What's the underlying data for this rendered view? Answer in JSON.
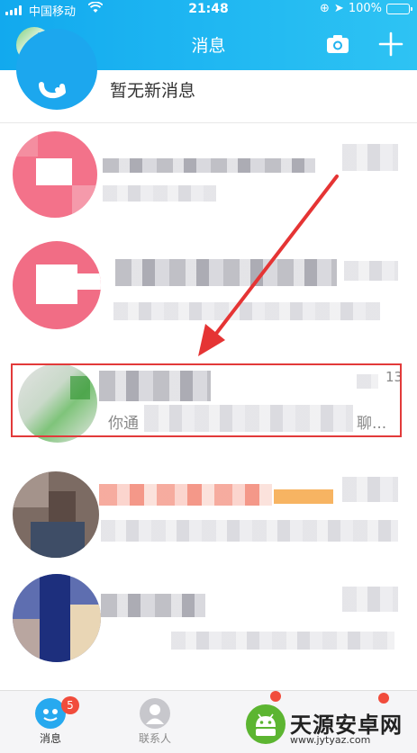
{
  "status": {
    "carrier": "中国移动",
    "time": "21:48",
    "battery": "100%"
  },
  "header": {
    "title": "消息"
  },
  "notice": {
    "text": "暂无新消息"
  },
  "chats": [
    {
      "time": "13",
      "preview_start": "你通",
      "preview_end": "聊..."
    }
  ],
  "tabs": [
    {
      "label": "消息",
      "badge": "5"
    },
    {
      "label": "联系人"
    }
  ],
  "watermark": {
    "text": "天源安卓网",
    "url": "www.jytyaz.com"
  },
  "colors": {
    "header": "#12a9ee",
    "highlight": "#e23a3a",
    "badge": "#f14c3c"
  }
}
